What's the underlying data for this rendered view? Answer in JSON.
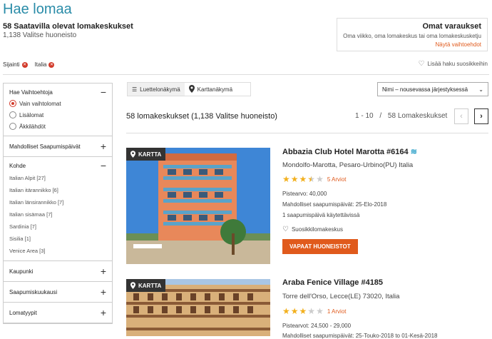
{
  "header": {
    "title": "Hae lomaa",
    "subtitle": "58 Saatavilla olevat lomakeskukset",
    "subcount": "1,138 Valitse huoneisto"
  },
  "reservations": {
    "heading": "Omat varaukset",
    "text": "Oma viikko, oma lomakeskus tai oma lomakeskusketju",
    "link": "Näytä vaihtoehdot"
  },
  "filters": {
    "chips": [
      "Sijainti",
      "Italia"
    ],
    "save_search": "Lisää haku suosikkeihin"
  },
  "sidebar": {
    "options": {
      "heading": "Hae Vaihtoehtoja",
      "radios": [
        "Vain vaihtolomat",
        "Lisälomat",
        "Äkkilähdöt"
      ]
    },
    "dates": "Mahdolliset Saapumispäivät",
    "destination": {
      "heading": "Kohde",
      "regions": [
        "Italian Alpit  [27]",
        "Italian itärannikko  [6]",
        "Italian länsirannikko  [7]",
        "Italian sisämaa  [7]",
        "Sardinia  [7]",
        "Sisilia  [1]",
        "Venice Area  [3]"
      ]
    },
    "city": "Kaupunki",
    "month": "Saapumiskuukausi",
    "types": "Lomatyypit"
  },
  "toolbar": {
    "list_view": "Luettelonäkymä",
    "map_view": "Karttanäkymä",
    "sort": "Nimi – nousevassa järjestyksessä"
  },
  "results": {
    "count": "58 lomakeskukset (1,138 Valitse huoneisto)",
    "range": "1 - 10",
    "separator": "/",
    "total": "58 Lomakeskukset",
    "prev": "‹",
    "next": "›",
    "map_badge": "KARTTA",
    "items": [
      {
        "name": "Abbazia Club Hotel Marotta #6164",
        "location": "Mondolfo-Marotta,  Pesaro-Urbino(PU)  Italia",
        "rating": 3.5,
        "reviews": "5 Arviot",
        "points": "Pistearvo: 40,000",
        "arrival": "Mahdolliset saapumispäivät: 25-Elo-2018",
        "available": "1 saapumispäivä käytettävissä",
        "fav": "Suosikkilomakeskus",
        "button": "VAPAAT HUONEISTOT"
      },
      {
        "name": "Araba Fenice Village #4185",
        "location": "Torre dell'Orso,  Lecce(LE)  73020,  Italia",
        "rating": 3,
        "reviews": "1 Arviot",
        "points": "Pistearvot: 24,500 - 29,000",
        "arrival": "Mahdolliset saapumispäivät: 25-Touko-2018 to 01-Kesä-2018"
      }
    ]
  }
}
